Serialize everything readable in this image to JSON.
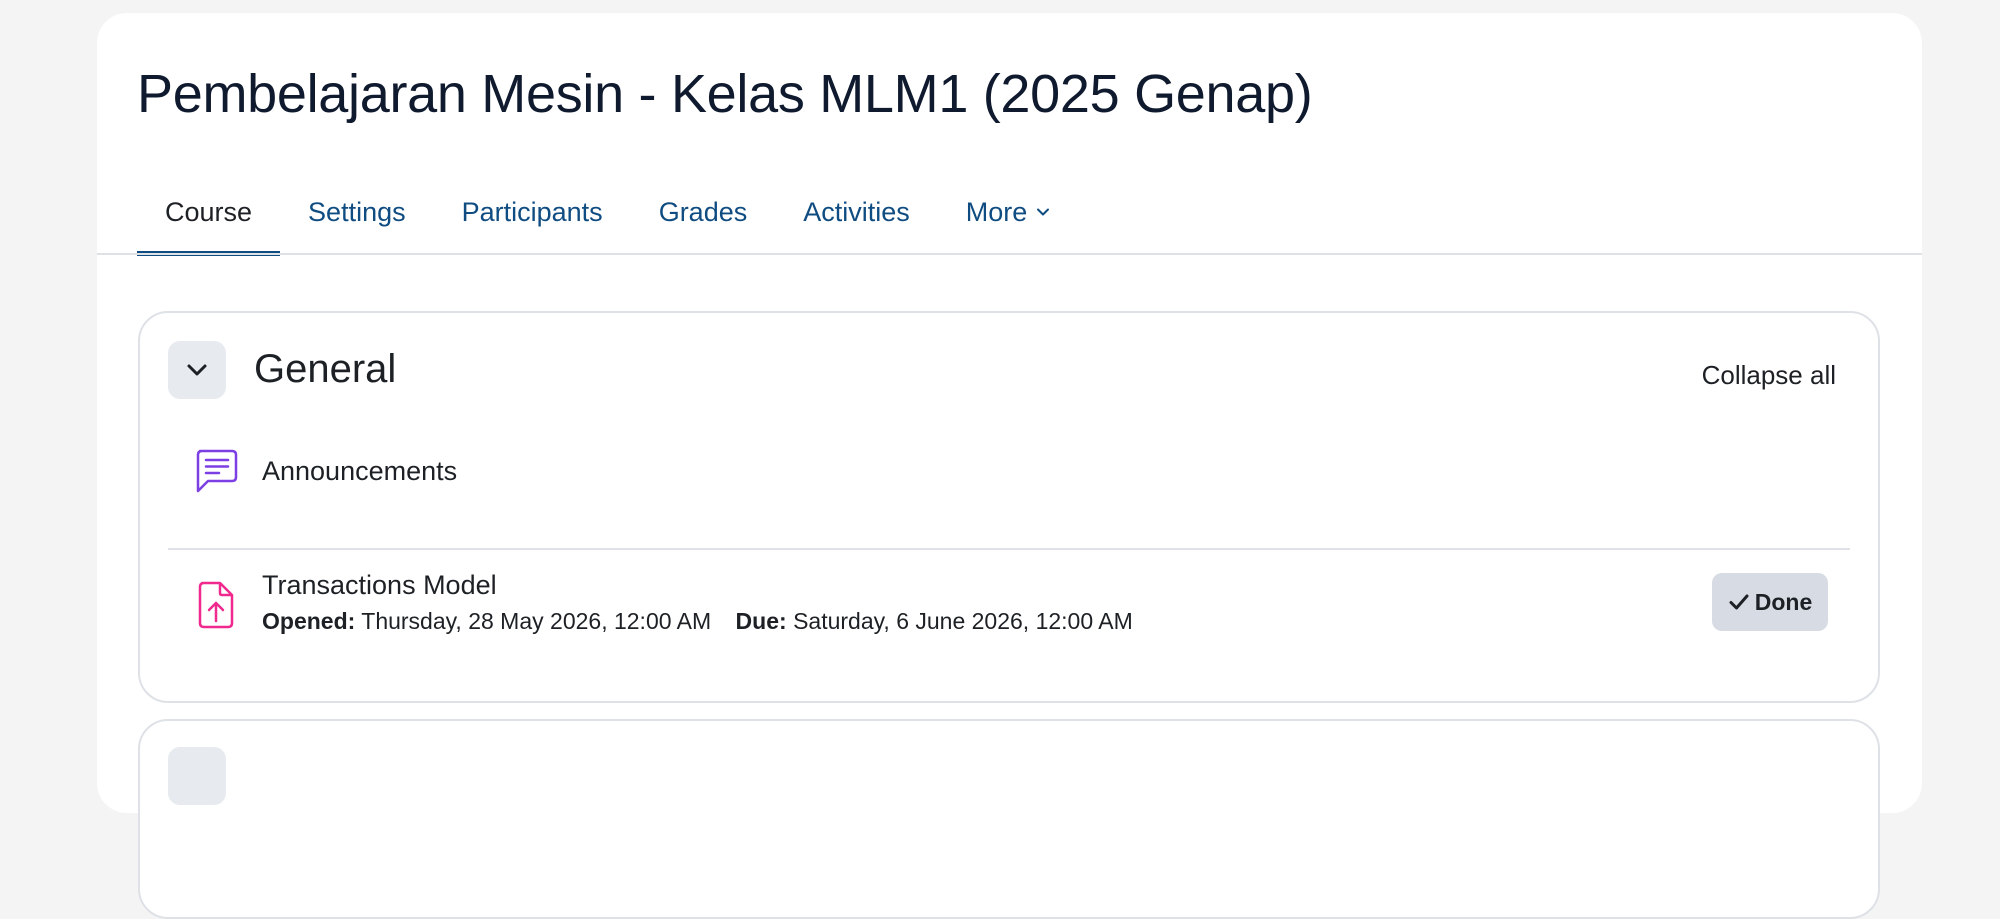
{
  "course": {
    "title": "Pembelajaran Mesin - Kelas MLM1 (2025 Genap)"
  },
  "tabs": [
    {
      "label": "Course",
      "active": true
    },
    {
      "label": "Settings"
    },
    {
      "label": "Participants"
    },
    {
      "label": "Grades"
    },
    {
      "label": "Activities"
    },
    {
      "label": "More"
    }
  ],
  "section": {
    "title": "General",
    "collapse_all_label": "Collapse all",
    "toggle_icon": "chevron-down-icon",
    "activities": [
      {
        "name": "Announcements",
        "icon": "forum-icon",
        "icon_color": "#7b3fe4"
      },
      {
        "name": "Transactions Model",
        "icon": "assignment-upload-icon",
        "icon_color": "#f0298e",
        "opened_label": "Opened:",
        "opened_value": "Thursday, 28 May 2026, 12:00 AM",
        "due_label": "Due:",
        "due_value": "Saturday, 6 June 2026, 12:00 AM",
        "completion_label": "Done"
      }
    ]
  },
  "colors": {
    "link": "#0f4c81",
    "text": "#1d2125",
    "border": "#dee2e6",
    "done_bg": "#d7dbe3"
  }
}
